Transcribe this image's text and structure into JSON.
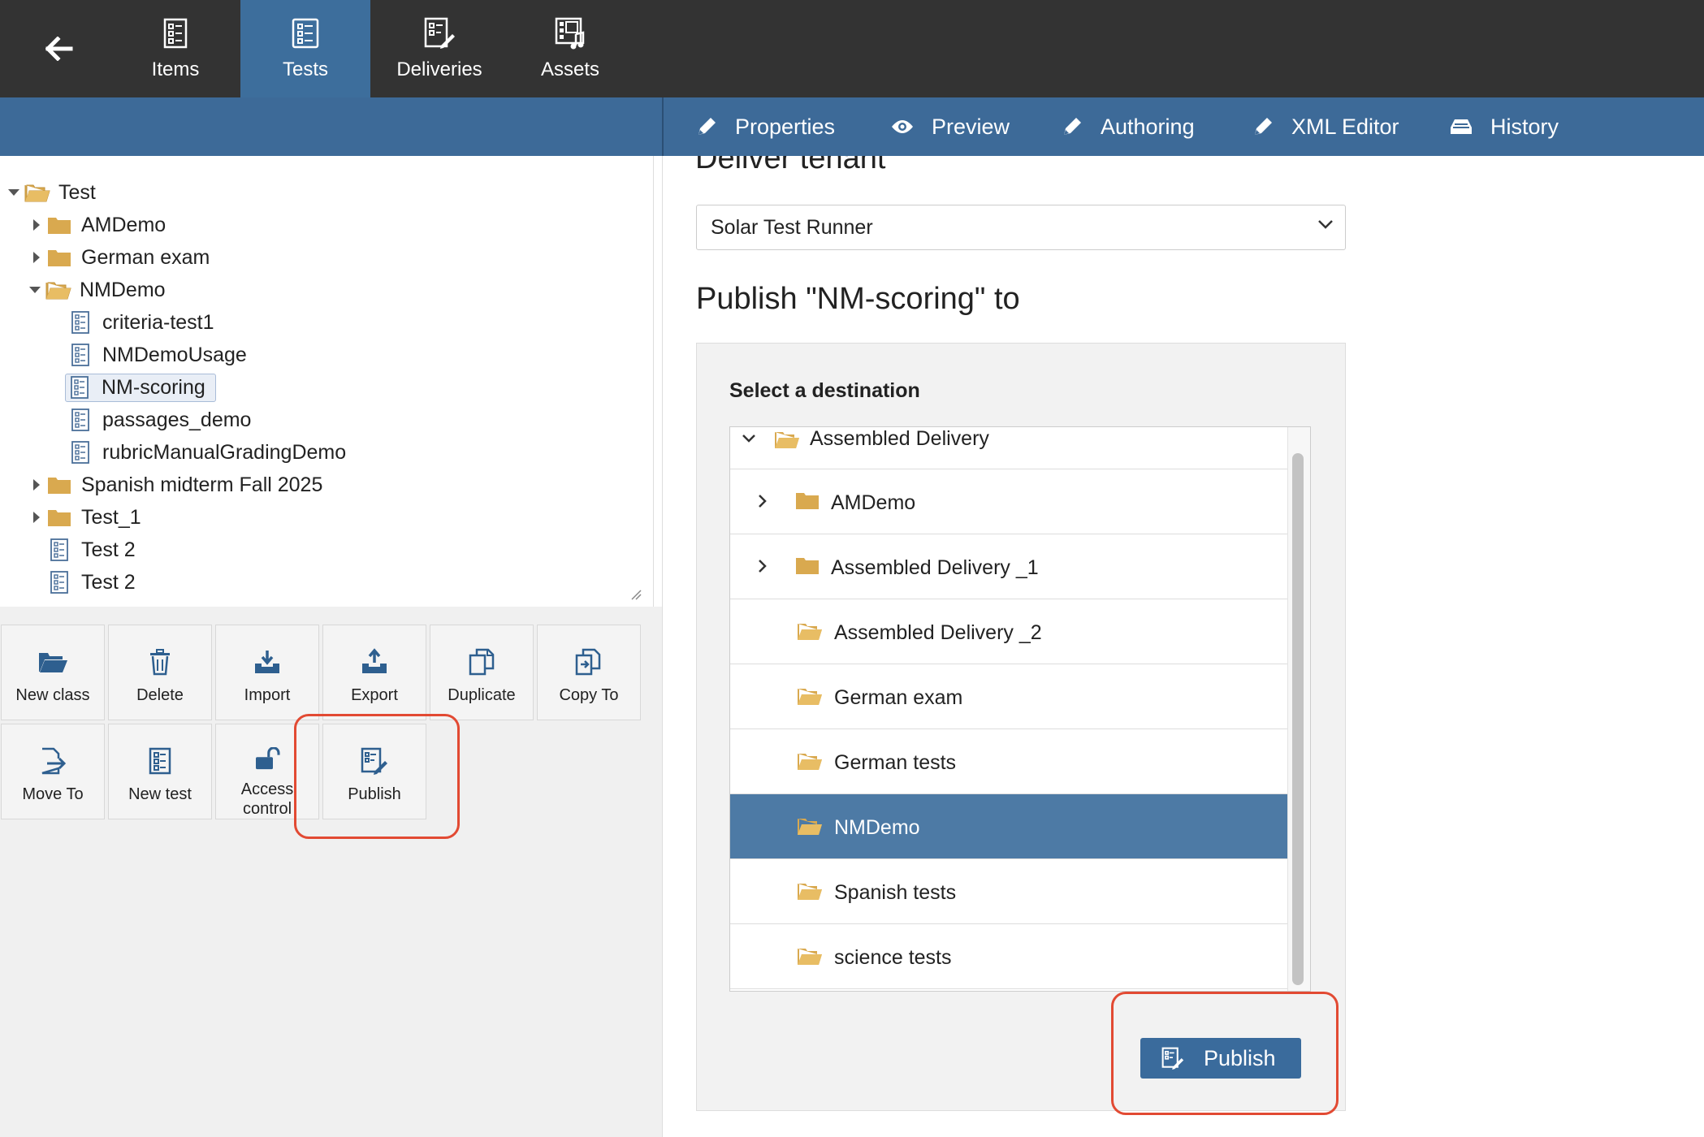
{
  "nav": {
    "back_label": "Back",
    "tabs": [
      {
        "label": "Items",
        "icon": "items-icon"
      },
      {
        "label": "Tests",
        "icon": "tests-icon",
        "active": true
      },
      {
        "label": "Deliveries",
        "icon": "deliveries-icon"
      },
      {
        "label": "Assets",
        "icon": "assets-icon"
      }
    ]
  },
  "right_tabs": [
    {
      "label": "Properties",
      "icon": "pencil-icon"
    },
    {
      "label": "Preview",
      "icon": "eye-icon"
    },
    {
      "label": "Authoring",
      "icon": "pencil-icon"
    },
    {
      "label": "XML Editor",
      "icon": "pencil-icon"
    },
    {
      "label": "History",
      "icon": "history-icon"
    }
  ],
  "tree": {
    "root": "Test",
    "items": [
      {
        "label": "AMDemo",
        "type": "folder",
        "expanded": false
      },
      {
        "label": "German exam",
        "type": "folder",
        "expanded": false
      },
      {
        "label": "NMDemo",
        "type": "folder",
        "expanded": true
      },
      {
        "label": "criteria-test1",
        "type": "test"
      },
      {
        "label": "NMDemoUsage",
        "type": "test"
      },
      {
        "label": "NM-scoring",
        "type": "test",
        "selected": true
      },
      {
        "label": "passages_demo",
        "type": "test"
      },
      {
        "label": "rubricManualGradingDemo",
        "type": "test"
      },
      {
        "label": "Spanish midterm Fall 2025",
        "type": "folder",
        "expanded": false
      },
      {
        "label": "Test_1",
        "type": "folder",
        "expanded": false
      },
      {
        "label": "Test 2",
        "type": "test"
      },
      {
        "label": "Test 2",
        "type": "test"
      }
    ]
  },
  "actions": [
    {
      "label": "New class",
      "icon": "folder-open-icon"
    },
    {
      "label": "Delete",
      "icon": "trash-icon"
    },
    {
      "label": "Import",
      "icon": "import-icon"
    },
    {
      "label": "Export",
      "icon": "export-icon"
    },
    {
      "label": "Duplicate",
      "icon": "duplicate-icon"
    },
    {
      "label": "Copy To",
      "icon": "copy-to-icon"
    },
    {
      "label": "Move To",
      "icon": "move-to-icon"
    },
    {
      "label": "New test",
      "icon": "new-test-icon"
    },
    {
      "label": "Access control",
      "icon": "unlock-icon"
    },
    {
      "label": "Publish",
      "icon": "publish-icon"
    }
  ],
  "main": {
    "tenant_heading": "Deliver tenant",
    "tenant_value": "Solar Test Runner",
    "publish_heading": "Publish \"NM-scoring\" to",
    "destination_title": "Select a destination",
    "destinations": [
      {
        "label": "Assembled Delivery",
        "level": 0,
        "expanded": true
      },
      {
        "label": "AMDemo",
        "level": 1,
        "collapsed": true
      },
      {
        "label": "Assembled Delivery _1",
        "level": 1,
        "collapsed": true
      },
      {
        "label": "Assembled Delivery _2",
        "level": 1
      },
      {
        "label": "German exam",
        "level": 1
      },
      {
        "label": "German tests",
        "level": 1
      },
      {
        "label": "NMDemo",
        "level": 1,
        "selected": true
      },
      {
        "label": "Spanish tests",
        "level": 1
      },
      {
        "label": "science tests",
        "level": 1
      }
    ],
    "publish_button": "Publish"
  },
  "colors": {
    "topbar": "#333333",
    "active_tab": "#3d6e9c",
    "header_blue": "#3d6a98",
    "selected_row": "#4d7aa5",
    "highlight": "#e24a33",
    "folder": "#d9a94f"
  }
}
